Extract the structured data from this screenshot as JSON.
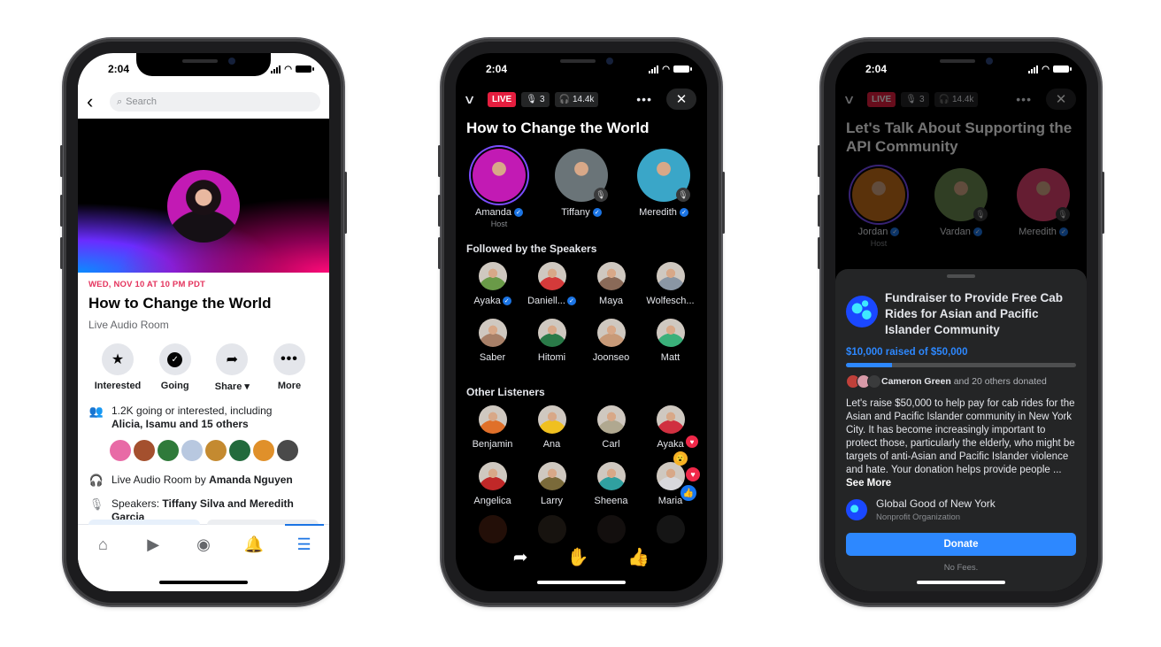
{
  "status_time": "2:04",
  "event_page": {
    "search_placeholder": "Search",
    "date": "WED, NOV 10 AT 10 PM PDT",
    "title": "How to Change the World",
    "type": "Live Audio Room",
    "actions": [
      {
        "label": "Interested",
        "icon": "star-icon"
      },
      {
        "label": "Going",
        "icon": "check-circle-icon"
      },
      {
        "label": "Share ▾",
        "icon": "share-arrow-icon"
      },
      {
        "label": "More",
        "icon": "more-dots-icon"
      }
    ],
    "going_text": "1.2K going or interested, including",
    "going_names": "Alicia, Isamu and 15 others",
    "attendee_colors": [
      "#e86aa6",
      "#a4502e",
      "#2f7a3a",
      "#b8c8e0",
      "#c48a30",
      "#226a3c",
      "#e0902a",
      "#4a4a4a"
    ],
    "host_prefix": "Live Audio Room by ",
    "host_name": "Amanda Nguyen",
    "speakers_prefix": "Speakers: ",
    "speakers_names": "Tiffany Silva and Meredith Garcia",
    "tabbar": [
      {
        "name": "home-icon",
        "glyph": "⌂"
      },
      {
        "name": "video-icon",
        "glyph": "▶"
      },
      {
        "name": "groups-icon",
        "glyph": "◉"
      },
      {
        "name": "bell-icon",
        "glyph": "🔔"
      },
      {
        "name": "menu-icon",
        "glyph": "☰",
        "active": true
      }
    ]
  },
  "live_room": {
    "live_label": "LIVE",
    "speaker_count": "3",
    "listener_count": "14.4k",
    "title": "How to Change the World",
    "speakers": [
      {
        "name": "Amanda",
        "role": "Host",
        "verified": true,
        "color": "#c21ab4"
      },
      {
        "name": "Tiffany",
        "verified": true,
        "color": "#6a7478"
      },
      {
        "name": "Meredith",
        "verified": true,
        "color": "#3aa6c8"
      }
    ],
    "followed_title": "Followed by the Speakers",
    "followed": [
      {
        "name": "Ayaka",
        "verified": true,
        "color": "#6a9a48"
      },
      {
        "name": "Daniell...",
        "verified": true,
        "color": "#d43a3a"
      },
      {
        "name": "Maya",
        "verified": false,
        "color": "#8a6a58"
      },
      {
        "name": "Wolfesch...",
        "verified": false,
        "color": "#8a96a4"
      },
      {
        "name": "Saber",
        "verified": false,
        "color": "#a88068"
      },
      {
        "name": "Hitomi",
        "verified": false,
        "color": "#2a7a48"
      },
      {
        "name": "Joonseo",
        "verified": false,
        "color": "#c89a78"
      },
      {
        "name": "Matt",
        "verified": false,
        "color": "#3ab07a"
      }
    ],
    "others_title": "Other Listeners",
    "others": [
      {
        "name": "Benjamin",
        "color": "#e0702a"
      },
      {
        "name": "Ana",
        "color": "#f0c020"
      },
      {
        "name": "Carl",
        "color": "#b0a890"
      },
      {
        "name": "Ayaka",
        "color": "#d03040"
      },
      {
        "name": "Angelica",
        "color": "#c02828"
      },
      {
        "name": "Larry",
        "color": "#7a6a3a"
      },
      {
        "name": "Sheena",
        "color": "#30a0a0"
      },
      {
        "name": "Maria",
        "color": "#d8d8dc"
      }
    ],
    "bottom_actions": [
      {
        "name": "share-icon",
        "glyph": "➦"
      },
      {
        "name": "raise-hand-icon",
        "glyph": "✋"
      },
      {
        "name": "like-icon",
        "glyph": "👍"
      }
    ]
  },
  "fundraiser_room": {
    "live_label": "LIVE",
    "speaker_count": "3",
    "listener_count": "14.4k",
    "title": "Let's Talk About Supporting the API Community",
    "speakers": [
      {
        "name": "Jordan",
        "role": "Host",
        "verified": true,
        "color": "#c8701a"
      },
      {
        "name": "Vardan",
        "verified": true,
        "color": "#6a8a50"
      },
      {
        "name": "Meredith",
        "verified": true,
        "color": "#e04070"
      }
    ],
    "sheet": {
      "title": "Fundraiser to Provide Free Cab Rides for Asian and Pacific Islander Community",
      "raised_text": "$10,000 raised of $50,000",
      "raised": 10000,
      "goal": 50000,
      "donor_name": "Cameron Green",
      "donor_suffix": " and 20 others donated",
      "description": "Let's raise $50,000 to help pay for cab rides for the Asian and Pacific Islander community in New York City. It has become increasingly important to protect those, particularly the elderly, who might be targets of anti-Asian and Pacific Islander violence and hate. Your donation helps provide people ... ",
      "see_more": "See More",
      "org_name": "Global Good of New York",
      "org_type": "Nonprofit Organization",
      "donate_label": "Donate",
      "fee_note": "No Fees."
    }
  }
}
